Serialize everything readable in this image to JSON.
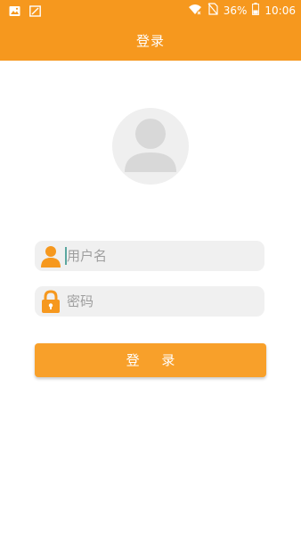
{
  "status_bar": {
    "battery_percent": "36%",
    "time": "10:06",
    "icons": [
      "image-icon",
      "screenshot-icon",
      "wifi-icon",
      "no-sim-icon",
      "battery-icon"
    ]
  },
  "header": {
    "title": "登录"
  },
  "avatar": {
    "icon": "user-avatar-placeholder-icon"
  },
  "form": {
    "username": {
      "placeholder": "用户名",
      "value": "",
      "icon": "user-icon"
    },
    "password": {
      "placeholder": "密码",
      "value": "",
      "icon": "lock-icon"
    },
    "submit_label": "登 录"
  },
  "colors": {
    "brand": "#F6981E",
    "button": "#F8A02A",
    "field_background": "#F0F0F0",
    "avatar_background": "#EFEFEF",
    "placeholder_text": "#9E9E9E"
  }
}
